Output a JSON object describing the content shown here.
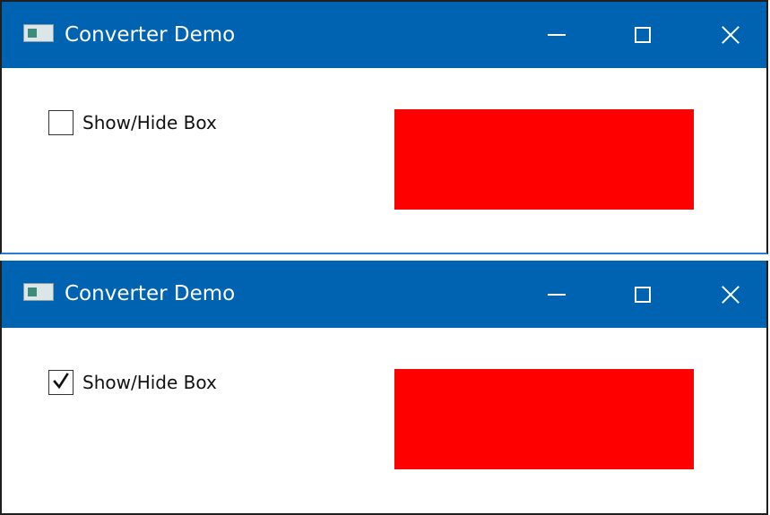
{
  "windows": [
    {
      "title": "Converter Demo",
      "checkbox": {
        "label": "Show/Hide Box",
        "checked": false
      },
      "box": {
        "color": "#ff0000"
      }
    },
    {
      "title": "Converter Demo",
      "checkbox": {
        "label": "Show/Hide Box",
        "checked": true
      },
      "box": {
        "color": "#ff0000"
      }
    }
  ],
  "colors": {
    "titlebar": "#0063b1",
    "box": "#ff0000"
  },
  "icons": {
    "app": "app-window-icon",
    "minimize": "minimize-icon",
    "maximize": "maximize-icon",
    "close": "close-icon",
    "check": "checkmark-icon"
  }
}
